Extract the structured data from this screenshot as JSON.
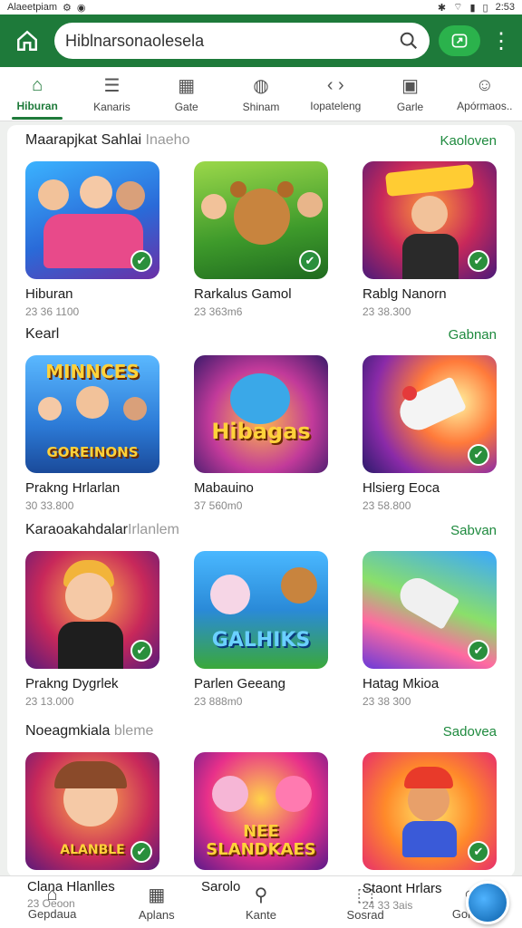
{
  "status": {
    "carrier": "Alaeetpiam",
    "time": "2:53"
  },
  "topbar": {
    "search_text": "Hiblnarsonaolesela"
  },
  "tabs": [
    {
      "label": "Hiburan",
      "icon": "home-icon",
      "active": true
    },
    {
      "label": "Kanaris",
      "icon": "list-icon",
      "active": false
    },
    {
      "label": "Gate",
      "icon": "calendar-icon",
      "active": false
    },
    {
      "label": "Shinam",
      "icon": "compass-icon",
      "active": false
    },
    {
      "label": "Iopateleng",
      "icon": "arrows-icon",
      "active": false
    },
    {
      "label": "Garle",
      "icon": "image-icon",
      "active": false
    },
    {
      "label": "Apórmaos..",
      "icon": "people-icon",
      "active": false
    }
  ],
  "sections": [
    {
      "title": "Maarapjkat Sahlai",
      "subtitle": "Inaeho",
      "more": "Kaoloven",
      "cards": [
        {
          "title": "Hiburan",
          "sub": "23 36 1100"
        },
        {
          "title": "Rarkalus Gamol",
          "sub": "23 363m6"
        },
        {
          "title": "Rablg Nanorn",
          "sub": "23 38.300"
        }
      ]
    },
    {
      "title": "Kearl",
      "subtitle": "",
      "more": "Gabnan",
      "cards": [
        {
          "title": "Prakng Hrlarlan",
          "sub": "30 33.800",
          "banner_top": "MINNCES",
          "banner_bottom": "GOREINONS"
        },
        {
          "title": "Mabauino",
          "sub": "37 560m0",
          "banner_top": "Hibagas"
        },
        {
          "title": "Hlsierg Eoca",
          "sub": "23 58.800"
        }
      ]
    },
    {
      "title": "Karaoakahdalar",
      "subtitle": "Irlanlem",
      "more": "Sabvan",
      "cards": [
        {
          "title": "Prakng Dygrlek",
          "sub": "23 13.000"
        },
        {
          "title": "Parlen Geeang",
          "sub": "23 888m0",
          "banner_top": "GALHIKS"
        },
        {
          "title": "Hatag Mkioa",
          "sub": "23 38 300"
        }
      ]
    },
    {
      "title": "Noeagmkiala",
      "subtitle": "bleme",
      "more": "Sadovea",
      "cards": [
        {
          "title": "Clana Hlanlles",
          "sub": "23 Oeoon",
          "banner_top": "ALANBLE"
        },
        {
          "title": "Sarolo",
          "sub": "",
          "banner_top": "NEE SLANDKAES"
        },
        {
          "title": "Staont Hrlars",
          "sub": "24 33 3ais"
        }
      ]
    }
  ],
  "bottomnav": [
    {
      "label": "Gepdaua",
      "icon": "home-icon"
    },
    {
      "label": "Aplans",
      "icon": "grid-icon"
    },
    {
      "label": "Kante",
      "icon": "search-icon"
    },
    {
      "label": "Sosrad",
      "icon": "share-icon"
    },
    {
      "label": "Gonao",
      "icon": "circle-icon"
    }
  ]
}
